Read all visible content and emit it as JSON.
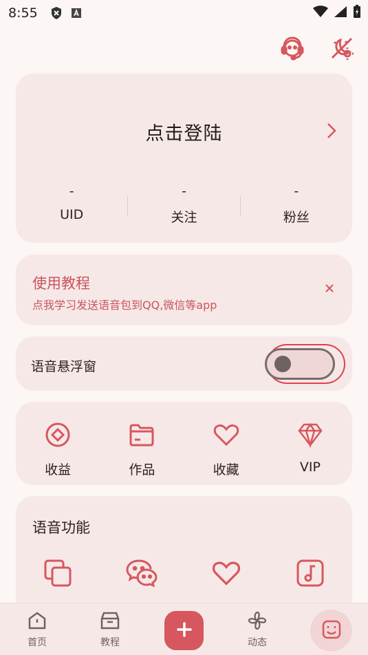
{
  "status_bar": {
    "time": "8:55"
  },
  "account": {
    "login_prompt": "点击登陆",
    "stats": [
      {
        "value": "-",
        "label": "UID"
      },
      {
        "value": "-",
        "label": "关注"
      },
      {
        "value": "-",
        "label": "粉丝"
      }
    ]
  },
  "tutorial": {
    "title": "使用教程",
    "subtitle": "点我学习发送语音包到QQ,微信等app"
  },
  "floating_window": {
    "label": "语音悬浮窗",
    "enabled": false
  },
  "quick_actions": [
    {
      "label": "收益",
      "icon": "earnings-icon"
    },
    {
      "label": "作品",
      "icon": "folder-icon"
    },
    {
      "label": "收藏",
      "icon": "heart-icon"
    },
    {
      "label": "VIP",
      "icon": "diamond-icon"
    }
  ],
  "voice_features": {
    "title": "语音功能",
    "icons": [
      "copy-icon",
      "wechat-icon",
      "heart-icon",
      "music-icon"
    ]
  },
  "tabbar": {
    "items": [
      {
        "label": "首页",
        "icon": "home-icon"
      },
      {
        "label": "教程",
        "icon": "tutorial-box-icon"
      },
      {
        "label": "",
        "icon": "add-icon"
      },
      {
        "label": "动态",
        "icon": "pinwheel-icon"
      },
      {
        "label": "",
        "icon": "smiley-icon"
      }
    ]
  },
  "colors": {
    "accent": "#D6575D",
    "card": "#F7E8E8",
    "background": "#FCF6F5",
    "highlight": "#E0404A"
  }
}
